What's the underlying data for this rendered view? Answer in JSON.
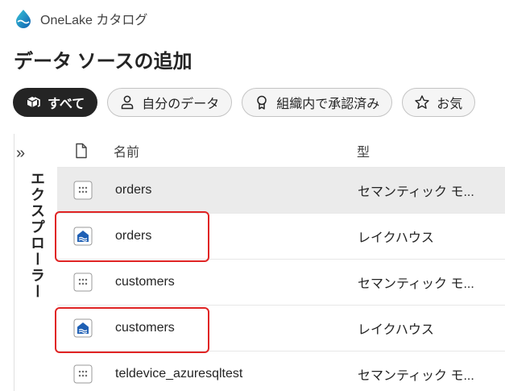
{
  "header": {
    "app_title": "OneLake カタログ",
    "logo_icon": "onelake-logo-icon"
  },
  "page_title": "データ ソースの追加",
  "filters": [
    {
      "label": "すべて",
      "icon": "cube-stack-icon",
      "active": true
    },
    {
      "label": "自分のデータ",
      "icon": "person-icon",
      "active": false
    },
    {
      "label": "組織内で承認済み",
      "icon": "ribbon-icon",
      "active": false
    },
    {
      "label": "お気",
      "icon": "star-icon",
      "active": false
    }
  ],
  "explorer": {
    "label": "エクスプローラー",
    "expand_icon": "chevron-double-right-icon"
  },
  "table": {
    "columns": {
      "name": "名前",
      "type": "型"
    },
    "rows": [
      {
        "name": "orders",
        "type": "セマンティック モ...",
        "icon": "semantic-model-icon",
        "selected": true,
        "highlighted": false
      },
      {
        "name": "orders",
        "type": "レイクハウス",
        "icon": "lakehouse-icon",
        "selected": false,
        "highlighted": true
      },
      {
        "name": "customers",
        "type": "セマンティック モ...",
        "icon": "semantic-model-icon",
        "selected": false,
        "highlighted": false
      },
      {
        "name": "customers",
        "type": "レイクハウス",
        "icon": "lakehouse-icon",
        "selected": false,
        "highlighted": true
      },
      {
        "name": "teldevice_azuresqltest",
        "type": "セマンティック モ...",
        "icon": "semantic-model-icon",
        "selected": false,
        "highlighted": false
      }
    ]
  },
  "colors": {
    "highlight": "#e02424",
    "lakehouse_blue": "#1e5fb4",
    "active_chip": "#242424"
  }
}
